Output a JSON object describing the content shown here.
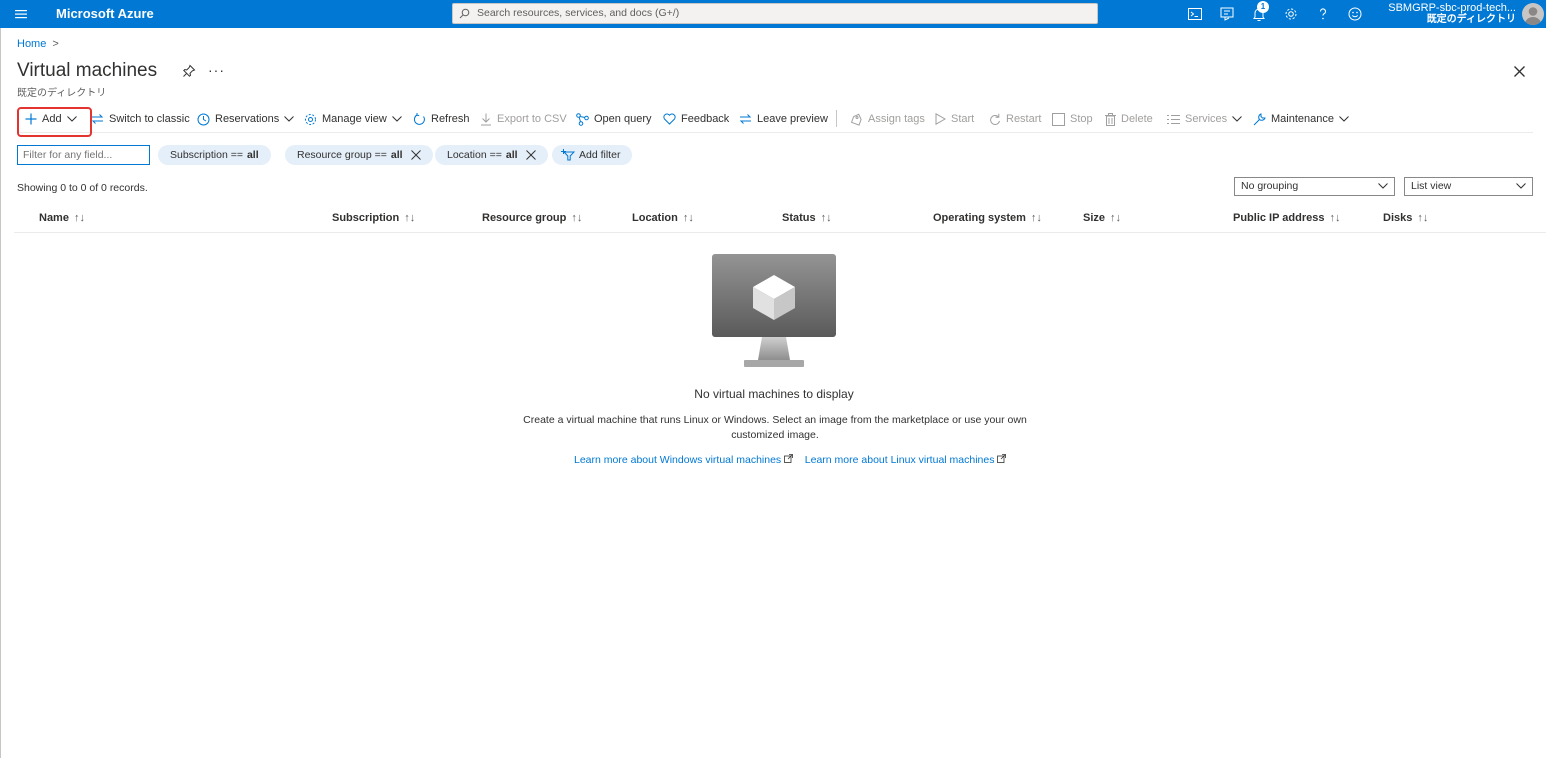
{
  "topbar": {
    "brand": "Microsoft Azure",
    "search_placeholder": "Search resources, services, and docs (G+/)",
    "notification_count": "1",
    "account_name": "SBMGRP-sbc-prod-tech...",
    "account_directory": "既定のディレクトリ",
    "icons": [
      "menu-icon",
      "cloud-shell-icon",
      "directory-filter-icon",
      "notifications-icon",
      "settings-icon",
      "help-icon",
      "feedback-smiley-icon"
    ]
  },
  "breadcrumb": {
    "home": "Home",
    "separator": ">"
  },
  "page": {
    "title": "Virtual machines",
    "subtitle": "既定のディレクトリ",
    "more": "···"
  },
  "toolbar": {
    "add": "Add",
    "switch_classic": "Switch to classic",
    "reservations": "Reservations",
    "manage_view": "Manage view",
    "refresh": "Refresh",
    "export_csv": "Export to CSV",
    "open_query": "Open query",
    "feedback": "Feedback",
    "leave_preview": "Leave preview",
    "assign_tags": "Assign tags",
    "start": "Start",
    "restart": "Restart",
    "stop": "Stop",
    "delete": "Delete",
    "services": "Services",
    "maintenance": "Maintenance"
  },
  "filters": {
    "placeholder": "Filter for any field...",
    "subscription_label": "Subscription ==",
    "subscription_value": "all",
    "resource_group_label": "Resource group ==",
    "resource_group_value": "all",
    "location_label": "Location ==",
    "location_value": "all",
    "add_filter": "Add filter"
  },
  "records_text": "Showing 0 to 0 of 0 records.",
  "grouping": "No grouping",
  "view_mode": "List view",
  "table": {
    "columns": [
      "Name",
      "Subscription",
      "Resource group",
      "Location",
      "Status",
      "Operating system",
      "Size",
      "Public IP address",
      "Disks"
    ],
    "sort_glyph": "↑↓"
  },
  "empty_state": {
    "title": "No virtual machines to display",
    "description": "Create a virtual machine that runs Linux or Windows. Select an image from the marketplace or use your own customized image.",
    "link_windows": "Learn more about Windows virtual machines",
    "link_linux": "Learn more about Linux virtual machines"
  },
  "colors": {
    "accent": "#0078d4",
    "highlight": "#e3342f",
    "pill": "#e5eff9"
  }
}
